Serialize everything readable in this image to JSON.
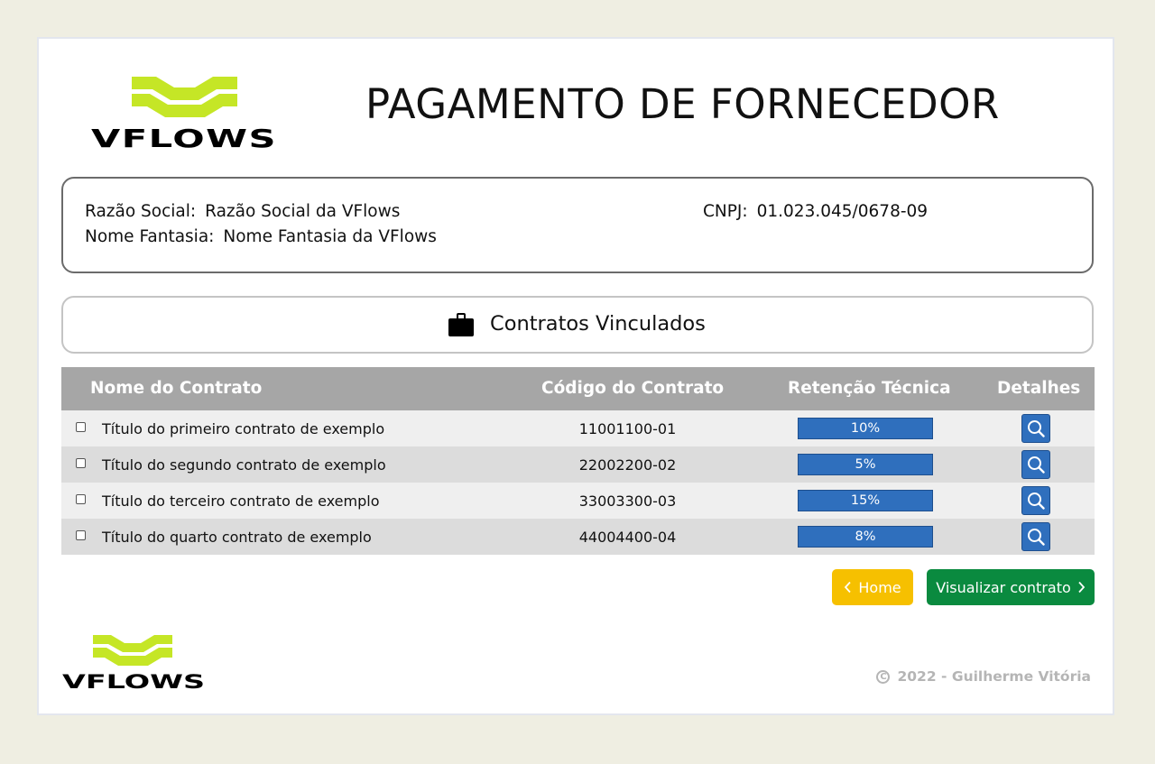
{
  "header": {
    "logo_text": "VFLOWS",
    "title": "PAGAMENTO DE FORNECEDOR"
  },
  "company": {
    "razao_label": "Razão Social:",
    "razao_value": "Razão Social da VFlows",
    "fantasia_label": "Nome Fantasia:",
    "fantasia_value": "Nome Fantasia da VFlows",
    "cnpj_label": "CNPJ:",
    "cnpj_value": "01.023.045/0678-09"
  },
  "section": {
    "title": "Contratos Vinculados",
    "icon": "briefcase-icon"
  },
  "table": {
    "columns": [
      "Nome do Contrato",
      "Código do Contrato",
      "Retenção Técnica",
      "Detalhes"
    ],
    "rows": [
      {
        "nome": "Título do primeiro contrato de exemplo",
        "codigo": "11001100-01",
        "retencao": "10%"
      },
      {
        "nome": "Título do segundo contrato de exemplo",
        "codigo": "22002200-02",
        "retencao": "5%"
      },
      {
        "nome": "Título do terceiro contrato de exemplo",
        "codigo": "33003300-03",
        "retencao": "15%"
      },
      {
        "nome": "Título do quarto contrato de exemplo",
        "codigo": "44004400-04",
        "retencao": "8%"
      }
    ]
  },
  "buttons": {
    "home": "Home",
    "visualizar": "Visualizar contrato"
  },
  "footer": {
    "logo_text": "VFLOWS",
    "copyright": "2022 - Guilherme Vitória"
  },
  "colors": {
    "background": "#efeee2",
    "brand_lime": "#c5e626",
    "primary_blue": "#2f6fbd",
    "home_yellow": "#f6c000",
    "visual_green": "#0a8a3f",
    "table_header": "#a6a6a6"
  }
}
